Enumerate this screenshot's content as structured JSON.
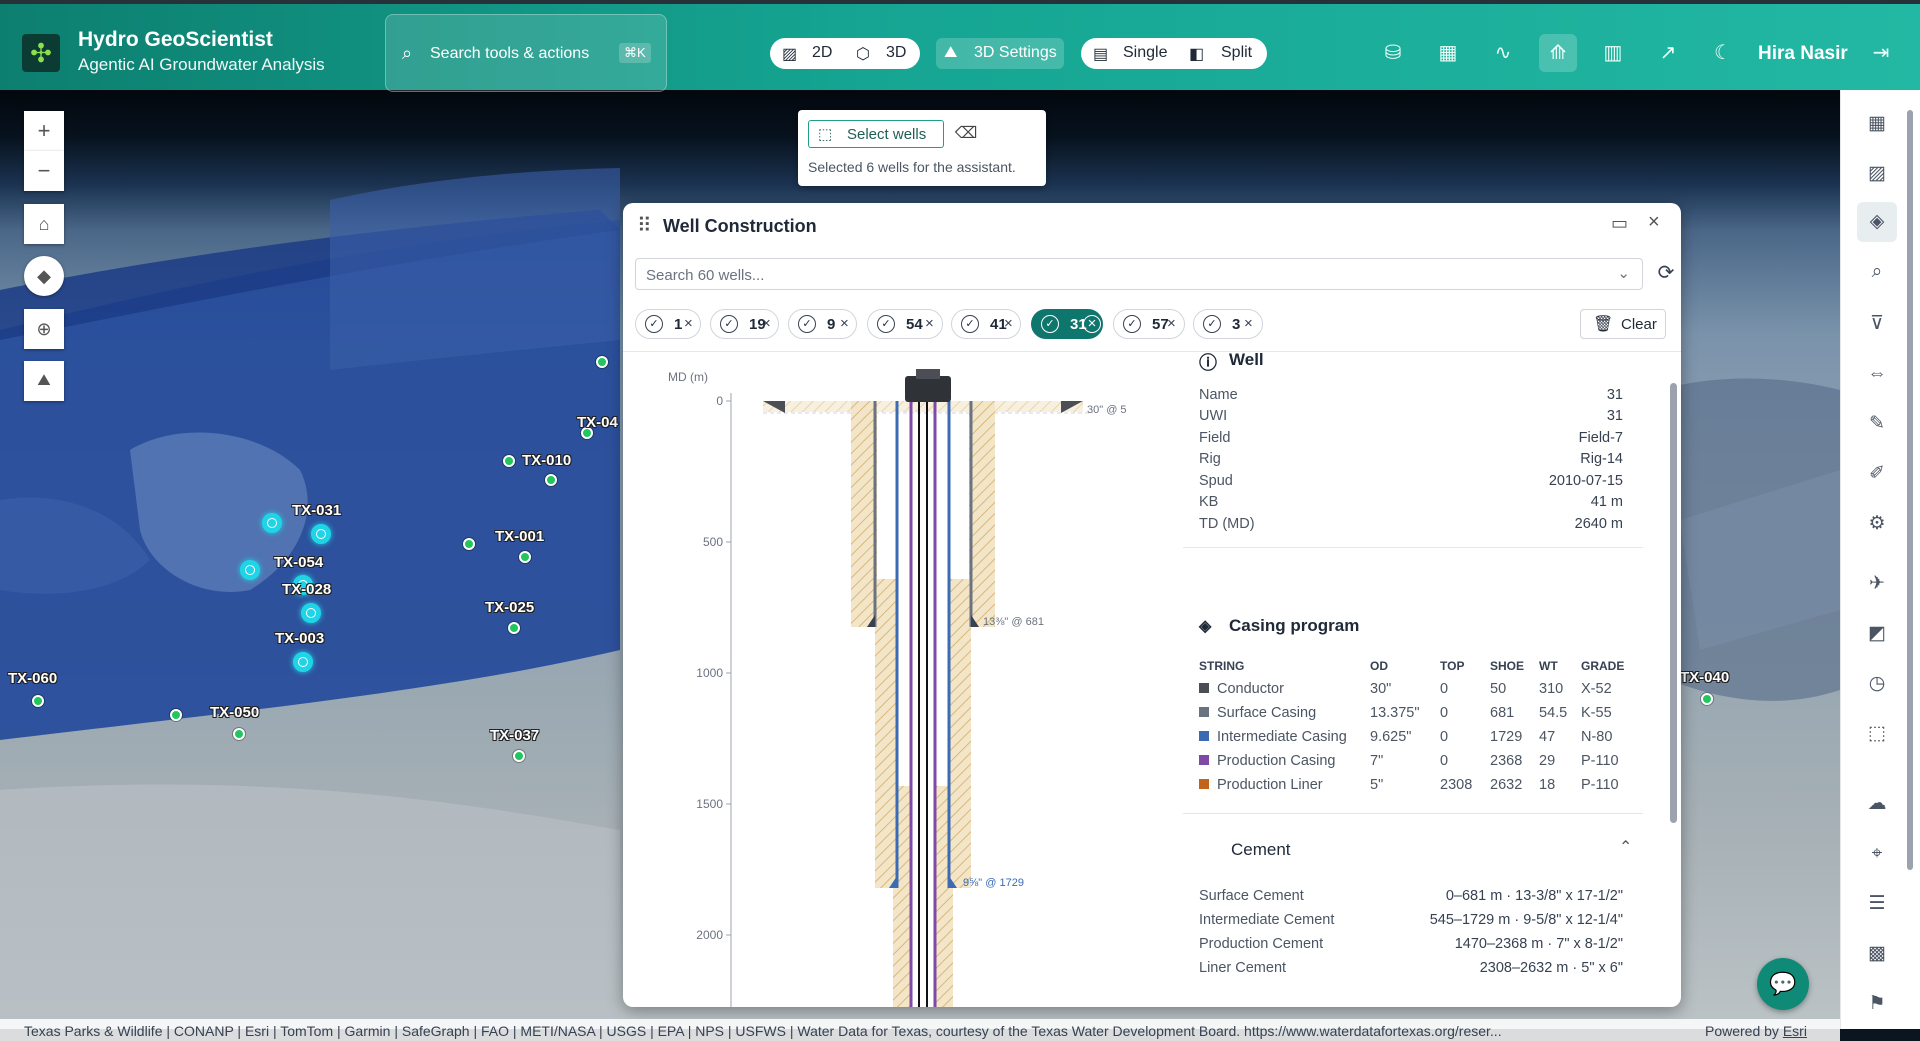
{
  "header": {
    "app_title": "Hydro GeoScientist",
    "app_subtitle": "Agentic AI Groundwater Analysis",
    "search_placeholder": "Search tools & actions",
    "search_shortcut": "⌘K",
    "view_2d": "2D",
    "view_3d": "3D",
    "settings_3d": "3D Settings",
    "layout_single": "Single",
    "layout_split": "Split",
    "user_name": "Hira Nasir"
  },
  "map": {
    "wells": [
      {
        "label": "TX-04"
      },
      {
        "label": "TX-010"
      },
      {
        "label": "TX-031"
      },
      {
        "label": "TX-001"
      },
      {
        "label": "TX-054"
      },
      {
        "label": "TX-028"
      },
      {
        "label": "TX-025"
      },
      {
        "label": "TX-003"
      },
      {
        "label": "TX-060"
      },
      {
        "label": "TX-050"
      },
      {
        "label": "TX-037"
      },
      {
        "label": "TX-040"
      }
    ],
    "attribution": "Texas Parks & Wildlife | CONANP | Esri | TomTom | Garmin | SafeGraph | FAO | METI/NASA | USGS | EPA | NPS | USFWS | Water Data for Texas, courtesy of the Texas Water Development Board. https://www.waterdatafortexas.org/reser...",
    "powered_by": "Powered by",
    "powered_by_link": "Esri"
  },
  "select_popover": {
    "button_label": "Select wells",
    "message": "Selected 6 wells for the assistant."
  },
  "panel": {
    "title": "Well Construction",
    "search_placeholder": "Search 60 wells...",
    "chips": [
      {
        "label": "1",
        "active": false
      },
      {
        "label": "19",
        "active": false
      },
      {
        "label": "9",
        "active": false
      },
      {
        "label": "54",
        "active": false
      },
      {
        "label": "41",
        "active": false
      },
      {
        "label": "31",
        "active": true
      },
      {
        "label": "57",
        "active": false
      },
      {
        "label": "3",
        "active": false
      }
    ],
    "clear_label": "Clear",
    "diagram": {
      "axis_label": "MD (m)",
      "ticks": [
        "0",
        "500",
        "1000",
        "1500",
        "2000"
      ],
      "annotations": [
        "30\" @ 5",
        "13⅜\" @ 681",
        "9⅝\" @ 1729"
      ]
    },
    "well": {
      "heading": "Well",
      "fields": [
        {
          "key": "Name",
          "value": "31"
        },
        {
          "key": "UWI",
          "value": "31"
        },
        {
          "key": "Field",
          "value": "Field-7"
        },
        {
          "key": "Rig",
          "value": "Rig-14"
        },
        {
          "key": "Spud",
          "value": "2010-07-15"
        },
        {
          "key": "KB",
          "value": "41 m"
        },
        {
          "key": "TD (MD)",
          "value": "2640 m"
        }
      ]
    },
    "casing": {
      "heading": "Casing program",
      "columns": [
        "STRING",
        "OD",
        "TOP",
        "SHOE",
        "WT",
        "GRADE"
      ],
      "rows": [
        {
          "string": "Conductor",
          "od": "30\"",
          "top": "0",
          "shoe": "50",
          "wt": "310",
          "grade": "X-52",
          "color": "#4b4f55"
        },
        {
          "string": "Surface Casing",
          "od": "13.375\"",
          "top": "0",
          "shoe": "681",
          "wt": "54.5",
          "grade": "K-55",
          "color": "#6b7280"
        },
        {
          "string": "Intermediate Casing",
          "od": "9.625\"",
          "top": "0",
          "shoe": "1729",
          "wt": "47",
          "grade": "N-80",
          "color": "#3b6cb3"
        },
        {
          "string": "Production Casing",
          "od": "7\"",
          "top": "0",
          "shoe": "2368",
          "wt": "29",
          "grade": "P-110",
          "color": "#7e4aa6"
        },
        {
          "string": "Production Liner",
          "od": "5\"",
          "top": "2308",
          "shoe": "2632",
          "wt": "18",
          "grade": "P-110",
          "color": "#c2651a"
        }
      ]
    },
    "cement": {
      "heading": "Cement",
      "rows": [
        {
          "key": "Surface Cement",
          "value": "0–681 m · 13-3/8\" x 17-1/2\""
        },
        {
          "key": "Intermediate Cement",
          "value": "545–1729 m · 9-5/8\" x 12-1/4\""
        },
        {
          "key": "Production Cement",
          "value": "1470–2368 m · 7\" x 8-1/2\""
        },
        {
          "key": "Liner Cement",
          "value": "2308–2632 m · 5\" x 6\""
        }
      ]
    }
  },
  "colors": {
    "accent": "#15a592",
    "selected_well": "#1fd4e6",
    "well_marker": "#22c55e"
  }
}
